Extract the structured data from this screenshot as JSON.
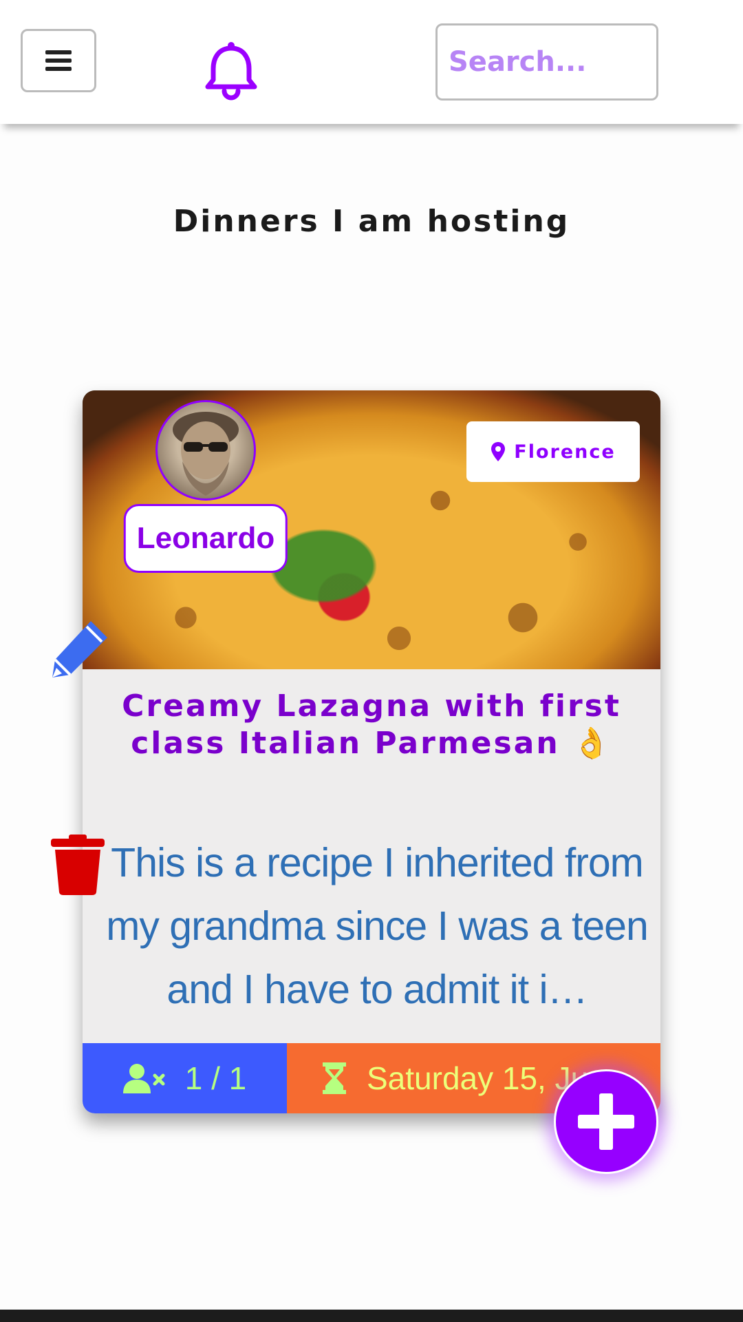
{
  "nav": {
    "menu_icon": "hamburger-icon",
    "notification_icon": "bell-icon",
    "search_placeholder": "Search..."
  },
  "page": {
    "title": "Dinners I am hosting"
  },
  "dinners": [
    {
      "host_name": "Leonardo",
      "location": "Florence",
      "title": "Creamy Lazagna with first class Italian Parmesan 👌",
      "description": "This is a recipe I inherited from my grandma since I was a teen and I have to admit it i…",
      "guests": "1 / 1",
      "date": "Saturday 15, Ju"
    }
  ],
  "actions": {
    "edit_icon": "pencil-icon",
    "delete_icon": "trash-icon",
    "add_icon": "plus-icon"
  },
  "colors": {
    "accent": "#8f00ff",
    "guests_bar": "#3d5afe",
    "date_bar": "#f66b30",
    "delete": "#d80000",
    "edit": "#3c6cf0"
  }
}
